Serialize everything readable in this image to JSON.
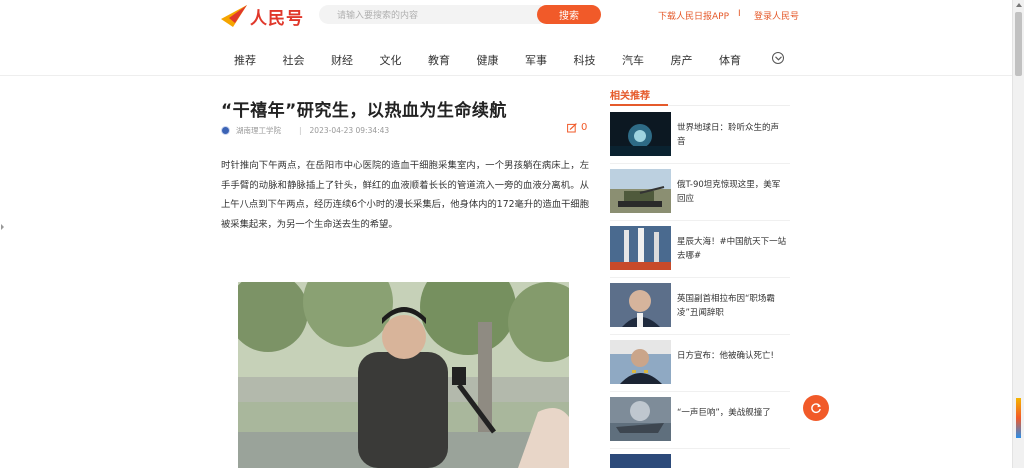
{
  "header": {
    "logo_text": "人民号",
    "search_placeholder": "请输入要搜索的内容",
    "search_button": "搜索",
    "download_app": "下载人民日报APP",
    "separator": "I",
    "login": "登录人民号"
  },
  "nav": {
    "items": [
      "推荐",
      "社会",
      "财经",
      "文化",
      "教育",
      "健康",
      "军事",
      "科技",
      "汽车",
      "房产",
      "体育"
    ]
  },
  "article": {
    "title": "“干禧年”研究生，以热血为生命续航",
    "source": "湖南理工学院",
    "separator": "|",
    "datetime": "2023-04-23 09:34:43",
    "comment_count": "0",
    "body": "时针推向下午两点，在岳阳市中心医院的造血干细胞采集室内，一个男孩躺在病床上，左手手臂的动脉和静脉插上了针头，鲜红的血液顺着长长的管道流入一旁的血液分离机。从上午八点到下午两点，经历连续6个小时的漫长采集后，他身体内的172毫升的造血干细胞被采集起来，为另一个生命送去生的希望。"
  },
  "sidebar": {
    "title": "相关推荐",
    "items": [
      {
        "title": "世界地球日：聆听众生的声音"
      },
      {
        "title": "俄T-90坦克惊现这里，美军回应"
      },
      {
        "title": "星辰大海！#中国航天下一站去哪#"
      },
      {
        "title": "英国副首相拉布因“职场霸凌”丑闻辞职"
      },
      {
        "title": "日方宣布：他被确认死亡!"
      },
      {
        "title": "“一声巨响”，美战舰撞了"
      }
    ]
  },
  "colors": {
    "accent": "#f15a29",
    "logo_red": "#e0382b"
  }
}
